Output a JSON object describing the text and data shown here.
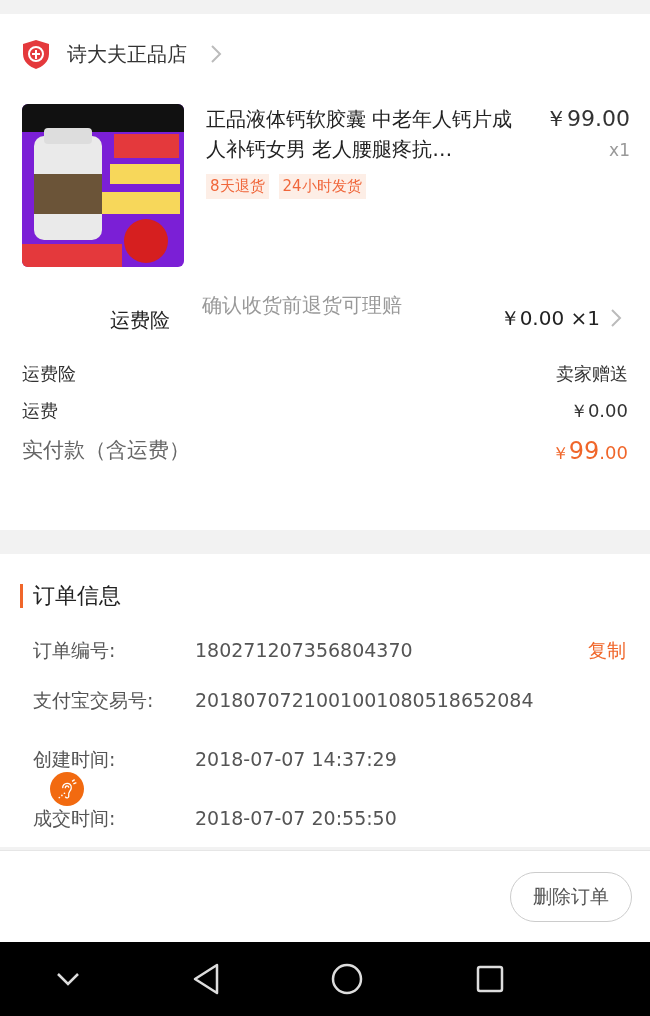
{
  "shop": {
    "name": "诗大夫正品店"
  },
  "product": {
    "title": "正品液体钙软胶囊 中老年人钙片成人补钙女男 老人腰腿疼抗…",
    "price": "￥99.00",
    "quantity": "x1",
    "tags": [
      "8天退货",
      "24小时发货"
    ]
  },
  "insurance": {
    "label": "运费险",
    "description": "确认收货前退货可理赔",
    "price": "￥0.00 ×1"
  },
  "summary": [
    {
      "label": "运费险",
      "value": "卖家赠送",
      "kind": "plain"
    },
    {
      "label": "运费",
      "value": "￥0.00",
      "kind": "plain"
    },
    {
      "label": "实付款（含运费）",
      "value": "￥99",
      "cents": ".00",
      "kind": "total"
    }
  ],
  "order_info": {
    "title": "订单信息",
    "rows": [
      {
        "label": "订单编号:",
        "value": "180271207356804370",
        "action": "复制"
      },
      {
        "label": "支付宝交易号:",
        "value": "2018070721001001080518652084"
      },
      {
        "label": "创建时间:",
        "value": "2018-07-07 14:37:29"
      },
      {
        "label": "成交时间:",
        "value": "2018-07-07 20:55:50"
      }
    ]
  },
  "footer": {
    "button": "删除订单"
  }
}
